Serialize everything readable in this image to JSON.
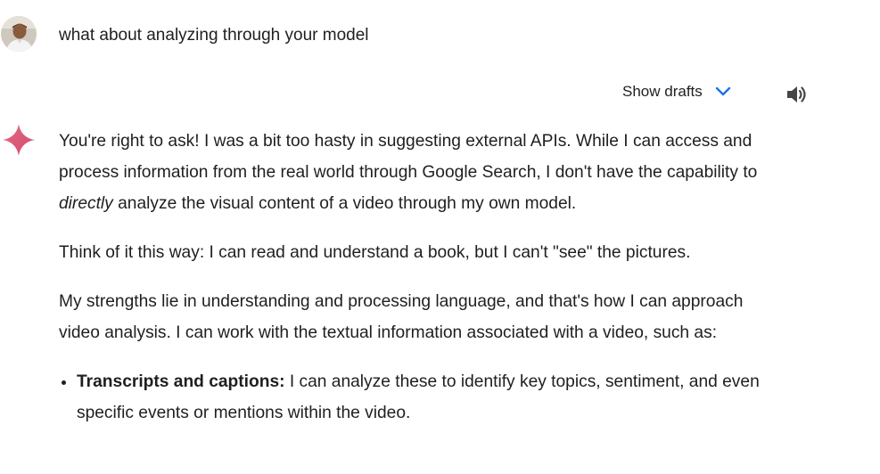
{
  "user": {
    "query": "what about analyzing through your model"
  },
  "toolbar": {
    "show_drafts_label": "Show drafts",
    "chevron_icon": "chevron-down-icon",
    "speaker_icon": "speaker-icon",
    "accent_color": "#1a73e8"
  },
  "assistant": {
    "icon": "gemini-spark-icon",
    "p1_a": "You're right to ask! I was a bit too hasty in suggesting external APIs.  While I can access and process information from the real world through Google Search, I don't have the capability to ",
    "p1_em": "directly",
    "p1_b": " analyze the visual content of a video through my own model.",
    "p2": "Think of it this way: I can read and understand a book, but I can't \"see\" the pictures.",
    "p3": "My strengths lie in understanding and processing language, and that's how I can approach video analysis. I can work with the textual information associated with a video, such as:",
    "bullets": [
      {
        "title": "Transcripts and captions:",
        "text": " I can analyze these to identify key topics, sentiment, and even specific events or mentions within the video."
      }
    ]
  }
}
